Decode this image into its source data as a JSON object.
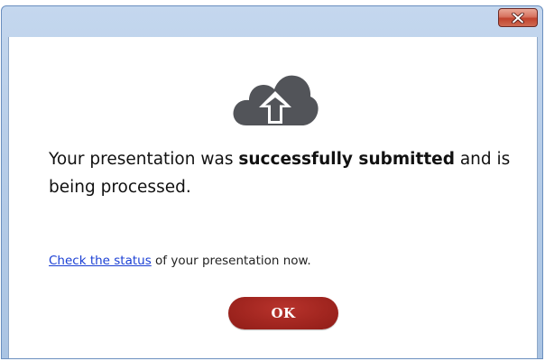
{
  "window": {
    "close_icon": "close-icon",
    "close_color": "#c6483a"
  },
  "dialog": {
    "icon": "cloud-upload-icon",
    "message_part1": "Your presentation was ",
    "message_bold": "successfully submitted",
    "message_part2": " and is being processed.",
    "status_link_text": "Check the status",
    "status_rest_text": " of your presentation now.",
    "ok_label": "OK",
    "link_color": "#1a3fd4",
    "ok_color": "#a22620"
  }
}
